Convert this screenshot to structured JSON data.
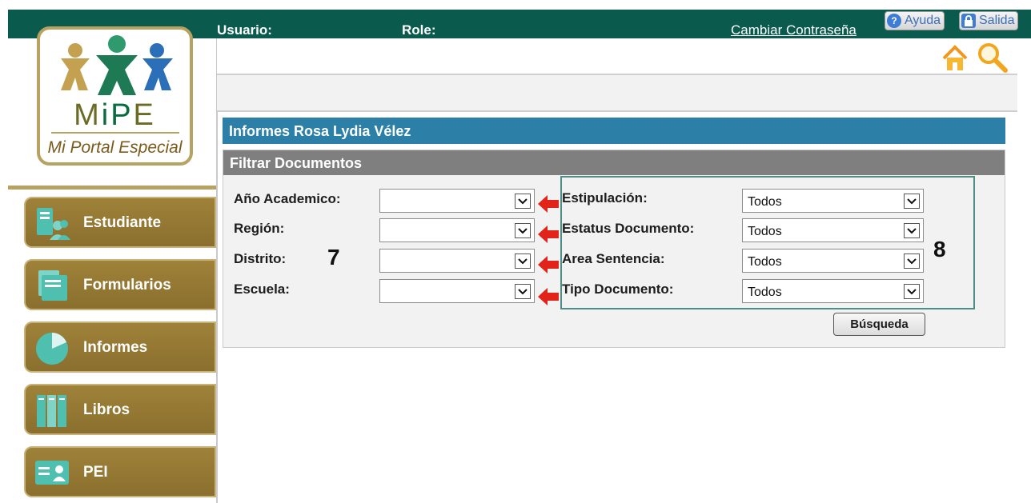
{
  "header": {
    "usuario_label": "Usuario:",
    "role_label": "Role:",
    "change_password": "Cambiar Contraseña",
    "help": "Ayuda",
    "logout": "Salida"
  },
  "logo": {
    "mipe": "MiPE",
    "tagline": "Mi Portal Especial"
  },
  "sidebar": {
    "items": [
      {
        "label": "Estudiante",
        "icon": "student-icon"
      },
      {
        "label": "Formularios",
        "icon": "forms-icon"
      },
      {
        "label": "Informes",
        "icon": "reports-icon"
      },
      {
        "label": "Libros",
        "icon": "books-icon"
      },
      {
        "label": "PEI",
        "icon": "pei-icon"
      }
    ]
  },
  "page": {
    "title": "Informes Rosa Lydia Vélez",
    "filter_title": "Filtrar Documentos",
    "left_filters": [
      {
        "label": "Año Academico:",
        "value": ""
      },
      {
        "label": "Región:",
        "value": ""
      },
      {
        "label": "Distrito:",
        "value": ""
      },
      {
        "label": "Escuela:",
        "value": ""
      }
    ],
    "right_filters": [
      {
        "label": "Estipulación:",
        "value": "Todos"
      },
      {
        "label": "Estatus Documento:",
        "value": "Todos"
      },
      {
        "label": "Area Sentencia:",
        "value": "Todos"
      },
      {
        "label": "Tipo Documento:",
        "value": "Todos"
      }
    ],
    "search_button": "Búsqueda",
    "annotation_left": "7",
    "annotation_right": "8"
  },
  "colors": {
    "topbar": "#0b5a4e",
    "nav": "#9f8239",
    "title_bar": "#2c80a7",
    "filter_head": "#7f7f7f",
    "annotation_arrow": "#e2231a"
  }
}
